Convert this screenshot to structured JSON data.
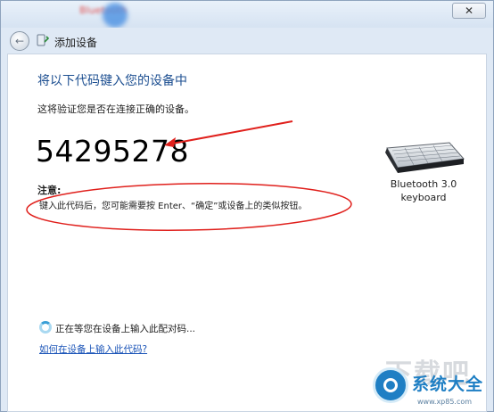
{
  "window": {
    "blurred_title": "Bluetooth",
    "close_label": "✕"
  },
  "nav": {
    "back_glyph": "←",
    "title": "添加设备"
  },
  "main": {
    "heading": "将以下代码键入您的设备中",
    "subtext": "这将验证您是否在连接正确的设备。",
    "pairing_code": "54295278",
    "note_title": "注意:",
    "note_text": "键入此代码后，您可能需要按 Enter、“确定”或设备上的类似按钮。"
  },
  "device": {
    "icon": "keyboard-icon",
    "name_line1": "Bluetooth 3.0",
    "name_line2": "keyboard"
  },
  "status": {
    "waiting_text": "正在等您在设备上输入此配对码...",
    "help_link": "如何在设备上输入此代码?"
  },
  "annotations": {
    "color": "#e0201c"
  },
  "watermark": {
    "faint_text": "下载吧",
    "name": "系统大全",
    "url": "www.xp85.com"
  },
  "colors": {
    "heading": "#1d4f91",
    "link": "#1c55b8",
    "watermark": "#1f7fc4"
  }
}
